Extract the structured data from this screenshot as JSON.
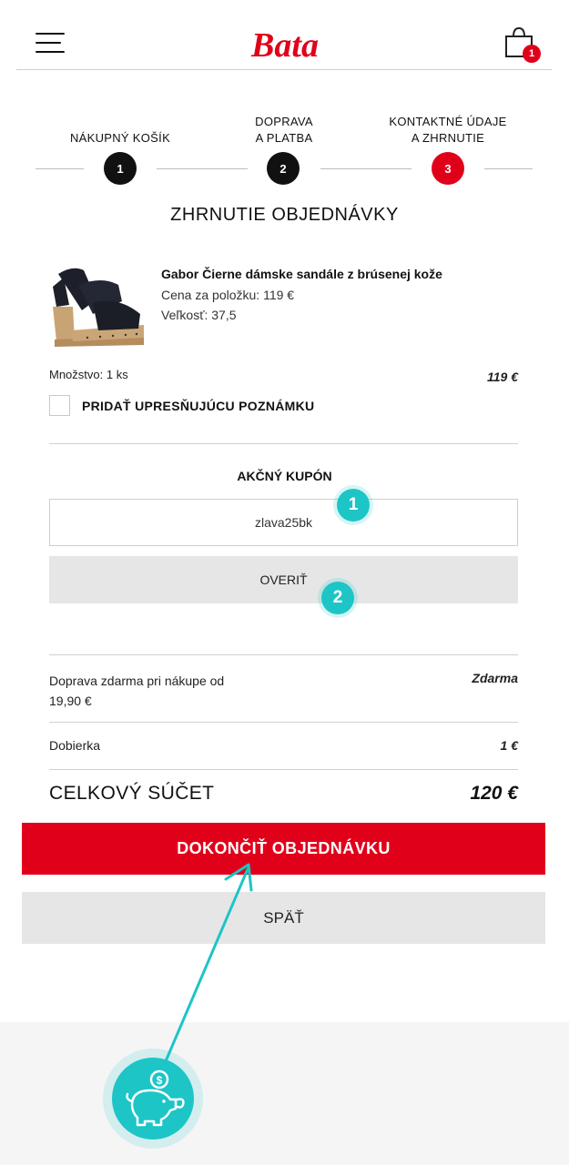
{
  "header": {
    "brand": "Bata",
    "cart_count": "1"
  },
  "steps": [
    {
      "label_line1": "NÁKUPNÝ KOŠÍK",
      "label_line2": "",
      "number": "1",
      "state": "done"
    },
    {
      "label_line1": "DOPRAVA",
      "label_line2": "A PLATBA",
      "number": "2",
      "state": "done"
    },
    {
      "label_line1": "KONTAKTNÉ ÚDAJE",
      "label_line2": "A ZHRNUTIE",
      "number": "3",
      "state": "active"
    }
  ],
  "summary_title": "ZHRNUTIE OBJEDNÁVKY",
  "product": {
    "name": "Gabor Čierne dámske sandále z brúsenej kože",
    "price_per_item": "Cena za položku: 119 €",
    "size": "Veľkosť: 37,5",
    "quantity": "Množstvo: 1 ks",
    "line_total": "119 €"
  },
  "note_checkbox_label": "PRIDAŤ UPRESŇUJÚCU POZNÁMKU",
  "coupon": {
    "title": "AKČNÝ KUPÓN",
    "value": "zlava25bk",
    "verify_label": "OVERIŤ"
  },
  "annotations": {
    "badge1": "1",
    "badge2": "2"
  },
  "costs": {
    "shipping_label_line1": "Doprava zdarma pri nákupe od",
    "shipping_label_line2": "19,90 €",
    "shipping_value": "Zdarma",
    "cod_label": "Dobierka",
    "cod_value": "1 €",
    "total_label": "CELKOVÝ SÚČET",
    "total_value": "120 €"
  },
  "buttons": {
    "complete_order": "DOKONČIŤ OBJEDNÁVKU",
    "back": "SPÄŤ"
  },
  "colors": {
    "brand_red": "#e1001a",
    "accent_teal": "#1dc5c6",
    "button_gray": "#e6e6e6"
  },
  "icons": {
    "menu": "hamburger-icon",
    "cart": "shopping-bag-icon",
    "savings": "piggy-bank-icon"
  }
}
